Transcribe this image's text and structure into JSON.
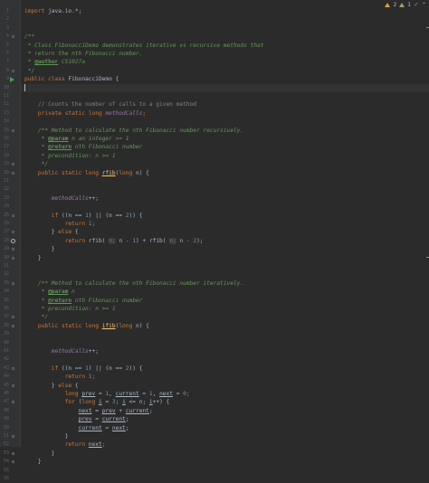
{
  "status": {
    "warnings": "2",
    "weak_warnings": "1"
  },
  "lines": [
    {
      "n": "1",
      "t": [
        {
          "c": "kw",
          "v": "import "
        },
        {
          "c": "",
          "v": "java.io.*;"
        }
      ]
    },
    {
      "n": "2",
      "t": []
    },
    {
      "n": "3",
      "t": []
    },
    {
      "n": "4",
      "t": [
        {
          "c": "doc",
          "v": "/**"
        }
      ],
      "fold": true
    },
    {
      "n": "5",
      "t": [
        {
          "c": "doc",
          "v": " * Class FibonacciDemo demonstrates iterative vs recursive methods that"
        }
      ]
    },
    {
      "n": "6",
      "t": [
        {
          "c": "doc",
          "v": " * return the nth Fibonacci number."
        }
      ]
    },
    {
      "n": "7",
      "t": [
        {
          "c": "doc",
          "v": " * "
        },
        {
          "c": "tag",
          "v": "@author"
        },
        {
          "c": "doc",
          "v": " CS1027a"
        }
      ]
    },
    {
      "n": "8",
      "t": [
        {
          "c": "doc",
          "v": " */"
        }
      ],
      "fold": true
    },
    {
      "n": "9",
      "t": [
        {
          "c": "kw",
          "v": "public class "
        },
        {
          "c": "",
          "v": "FibonacciDemo {"
        }
      ],
      "run": true
    },
    {
      "n": "10",
      "t": [],
      "current": true,
      "caret": true
    },
    {
      "n": "11",
      "t": []
    },
    {
      "n": "12",
      "t": [
        {
          "c": "cm",
          "v": "    // Counts the number of calls to a given method"
        }
      ]
    },
    {
      "n": "13",
      "t": [
        {
          "c": "kw",
          "v": "    private static long "
        },
        {
          "c": "fld",
          "v": "methodCalls"
        },
        {
          "c": "kw",
          "v": ";"
        }
      ]
    },
    {
      "n": "14",
      "t": []
    },
    {
      "n": "15",
      "t": [
        {
          "c": "doc",
          "v": "    /** Method to calculate the nth Fibonacci number recursively."
        }
      ],
      "fold": true
    },
    {
      "n": "16",
      "t": [
        {
          "c": "doc",
          "v": "     * "
        },
        {
          "c": "tag",
          "v": "@param"
        },
        {
          "c": "doc",
          "v": " n an integer >= 1"
        }
      ]
    },
    {
      "n": "17",
      "t": [
        {
          "c": "doc",
          "v": "     * "
        },
        {
          "c": "tag",
          "v": "@return"
        },
        {
          "c": "doc",
          "v": " nth Fibonacci number"
        }
      ]
    },
    {
      "n": "18",
      "t": [
        {
          "c": "doc",
          "v": "     * precondition: n >= 1"
        }
      ]
    },
    {
      "n": "19",
      "t": [
        {
          "c": "doc",
          "v": "     */"
        }
      ],
      "fold": true
    },
    {
      "n": "20",
      "t": [
        {
          "c": "kw",
          "v": "    public static long "
        },
        {
          "c": "mth ul",
          "v": "rfib"
        },
        {
          "c": "",
          "v": "("
        },
        {
          "c": "kw",
          "v": "long "
        },
        {
          "c": "",
          "v": "n) {"
        }
      ],
      "fold": true
    },
    {
      "n": "21",
      "t": []
    },
    {
      "n": "22",
      "t": []
    },
    {
      "n": "23",
      "t": [
        {
          "c": "fld",
          "v": "        methodCalls"
        },
        {
          "c": "",
          "v": "++;"
        }
      ]
    },
    {
      "n": "24",
      "t": []
    },
    {
      "n": "25",
      "t": [
        {
          "c": "kw",
          "v": "        if "
        },
        {
          "c": "",
          "v": "((n == "
        },
        {
          "c": "num",
          "v": "1"
        },
        {
          "c": "",
          "v": ") || (n == "
        },
        {
          "c": "num",
          "v": "2"
        },
        {
          "c": "",
          "v": ")) {"
        }
      ],
      "fold": true
    },
    {
      "n": "26",
      "t": [
        {
          "c": "kw",
          "v": "            return "
        },
        {
          "c": "num",
          "v": "1"
        },
        {
          "c": "kw",
          "v": ";"
        }
      ]
    },
    {
      "n": "27",
      "t": [
        {
          "c": "",
          "v": "        } "
        },
        {
          "c": "kw",
          "v": "else "
        },
        {
          "c": "",
          "v": "{"
        }
      ],
      "fold": true
    },
    {
      "n": "28",
      "t": [
        {
          "c": "kw",
          "v": "            return "
        },
        {
          "c": "",
          "v": "rfib( "
        },
        {
          "c": "hint",
          "v": "n:"
        },
        {
          "c": "",
          "v": " n - "
        },
        {
          "c": "num",
          "v": "1"
        },
        {
          "c": "",
          "v": ") + rfib( "
        },
        {
          "c": "hint",
          "v": "n:"
        },
        {
          "c": "",
          "v": " n - "
        },
        {
          "c": "num",
          "v": "2"
        },
        {
          "c": "",
          "v": ");"
        }
      ],
      "recursion": true
    },
    {
      "n": "29",
      "t": [
        {
          "c": "",
          "v": "        }"
        }
      ],
      "fold": true
    },
    {
      "n": "30",
      "t": [
        {
          "c": "",
          "v": "    }"
        }
      ],
      "fold": true
    },
    {
      "n": "31",
      "t": []
    },
    {
      "n": "32",
      "t": []
    },
    {
      "n": "33",
      "t": [
        {
          "c": "doc",
          "v": "    /** Method to calculate the nth Fibonacci number iteratively."
        }
      ],
      "fold": true
    },
    {
      "n": "34",
      "t": [
        {
          "c": "doc",
          "v": "     * "
        },
        {
          "c": "tag",
          "v": "@param"
        },
        {
          "c": "doc",
          "v": " n"
        }
      ]
    },
    {
      "n": "35",
      "t": [
        {
          "c": "doc",
          "v": "     * "
        },
        {
          "c": "tag",
          "v": "@return"
        },
        {
          "c": "doc",
          "v": " nth Fibonacci number"
        }
      ]
    },
    {
      "n": "36",
      "t": [
        {
          "c": "doc",
          "v": "     * precondition: n >= 1"
        }
      ]
    },
    {
      "n": "37",
      "t": [
        {
          "c": "doc",
          "v": "     */"
        }
      ],
      "fold": true
    },
    {
      "n": "38",
      "t": [
        {
          "c": "kw",
          "v": "    public static long "
        },
        {
          "c": "mth ul",
          "v": "ifib"
        },
        {
          "c": "",
          "v": "("
        },
        {
          "c": "kw",
          "v": "long "
        },
        {
          "c": "",
          "v": "n) {"
        }
      ],
      "fold": true
    },
    {
      "n": "39",
      "t": []
    },
    {
      "n": "40",
      "t": []
    },
    {
      "n": "41",
      "t": [
        {
          "c": "fld",
          "v": "        methodCalls"
        },
        {
          "c": "",
          "v": "++;"
        }
      ]
    },
    {
      "n": "42",
      "t": []
    },
    {
      "n": "43",
      "t": [
        {
          "c": "kw",
          "v": "        if "
        },
        {
          "c": "",
          "v": "((n == "
        },
        {
          "c": "num",
          "v": "1"
        },
        {
          "c": "",
          "v": ") || (n == "
        },
        {
          "c": "num",
          "v": "2"
        },
        {
          "c": "",
          "v": ")) {"
        }
      ],
      "fold": true
    },
    {
      "n": "44",
      "t": [
        {
          "c": "kw",
          "v": "            return "
        },
        {
          "c": "num",
          "v": "1"
        },
        {
          "c": "kw",
          "v": ";"
        }
      ]
    },
    {
      "n": "45",
      "t": [
        {
          "c": "",
          "v": "        } "
        },
        {
          "c": "kw",
          "v": "else "
        },
        {
          "c": "",
          "v": "{"
        }
      ],
      "fold": true
    },
    {
      "n": "46",
      "t": [
        {
          "c": "kw",
          "v": "            long "
        },
        {
          "c": "ul",
          "v": "prev"
        },
        {
          "c": "",
          "v": " = "
        },
        {
          "c": "num",
          "v": "1"
        },
        {
          "c": "",
          "v": ", "
        },
        {
          "c": "ul",
          "v": "current"
        },
        {
          "c": "",
          "v": " = "
        },
        {
          "c": "num",
          "v": "1"
        },
        {
          "c": "",
          "v": ", "
        },
        {
          "c": "ul",
          "v": "next"
        },
        {
          "c": "",
          "v": " = "
        },
        {
          "c": "num",
          "v": "0"
        },
        {
          "c": "kw",
          "v": ";"
        }
      ]
    },
    {
      "n": "47",
      "t": [
        {
          "c": "kw",
          "v": "            for "
        },
        {
          "c": "",
          "v": "("
        },
        {
          "c": "kw",
          "v": "long "
        },
        {
          "c": "ul",
          "v": "i"
        },
        {
          "c": "",
          "v": " = "
        },
        {
          "c": "num",
          "v": "3"
        },
        {
          "c": "",
          "v": "; "
        },
        {
          "c": "ul",
          "v": "i"
        },
        {
          "c": "",
          "v": " <= n; "
        },
        {
          "c": "ul",
          "v": "i"
        },
        {
          "c": "",
          "v": "++) {"
        }
      ],
      "fold": true
    },
    {
      "n": "48",
      "t": [
        {
          "c": "",
          "v": "                "
        },
        {
          "c": "ul",
          "v": "next"
        },
        {
          "c": "",
          "v": " = "
        },
        {
          "c": "ul",
          "v": "prev"
        },
        {
          "c": "",
          "v": " + "
        },
        {
          "c": "ul",
          "v": "current"
        },
        {
          "c": "",
          "v": ";"
        }
      ]
    },
    {
      "n": "49",
      "t": [
        {
          "c": "",
          "v": "                "
        },
        {
          "c": "ul",
          "v": "prev"
        },
        {
          "c": "",
          "v": " = "
        },
        {
          "c": "ul",
          "v": "current"
        },
        {
          "c": "",
          "v": ";"
        }
      ]
    },
    {
      "n": "50",
      "t": [
        {
          "c": "",
          "v": "                "
        },
        {
          "c": "ul",
          "v": "current"
        },
        {
          "c": "",
          "v": " = "
        },
        {
          "c": "ul",
          "v": "next"
        },
        {
          "c": "",
          "v": ";"
        }
      ]
    },
    {
      "n": "51",
      "t": [
        {
          "c": "",
          "v": "            }"
        }
      ],
      "fold": true
    },
    {
      "n": "52",
      "t": [
        {
          "c": "kw",
          "v": "            return "
        },
        {
          "c": "ul",
          "v": "next"
        },
        {
          "c": "kw",
          "v": ";"
        }
      ]
    },
    {
      "n": "53",
      "t": [
        {
          "c": "",
          "v": "        }"
        }
      ],
      "fold": true
    },
    {
      "n": "54",
      "t": [
        {
          "c": "",
          "v": "    }"
        }
      ],
      "fold": true
    },
    {
      "n": "55",
      "t": []
    },
    {
      "n": "56",
      "t": []
    }
  ]
}
